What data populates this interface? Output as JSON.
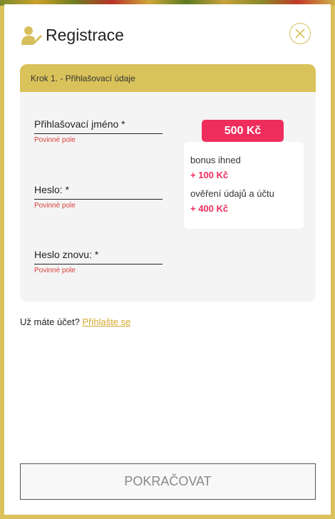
{
  "modal": {
    "title": "Registrace",
    "close_icon": "close-icon",
    "header_icon": "user-check-icon"
  },
  "form": {
    "step_label": "Krok 1. - Přihlašovací údaje",
    "fields": [
      {
        "label": "Přihlašovací jméno *",
        "error": "Povinné pole"
      },
      {
        "label": "Heslo: *",
        "error": "Povinné pole"
      },
      {
        "label": "Heslo znovu: *",
        "error": "Povinné pole"
      }
    ]
  },
  "bonus": {
    "badge": "500 Kč",
    "line1": "bonus ihned",
    "amount1": "+ 100 Kč",
    "line2": "ověření údajů a účtu",
    "amount2": "+ 400 Kč"
  },
  "login": {
    "prompt": "Už máte účet?",
    "link": "Přihlašte se"
  },
  "actions": {
    "continue_label": "POKRAČOVAT"
  },
  "colors": {
    "accent": "#d9c25a",
    "bonus": "#ee2d5c",
    "error": "#d9403a",
    "link": "#d4a72a"
  }
}
